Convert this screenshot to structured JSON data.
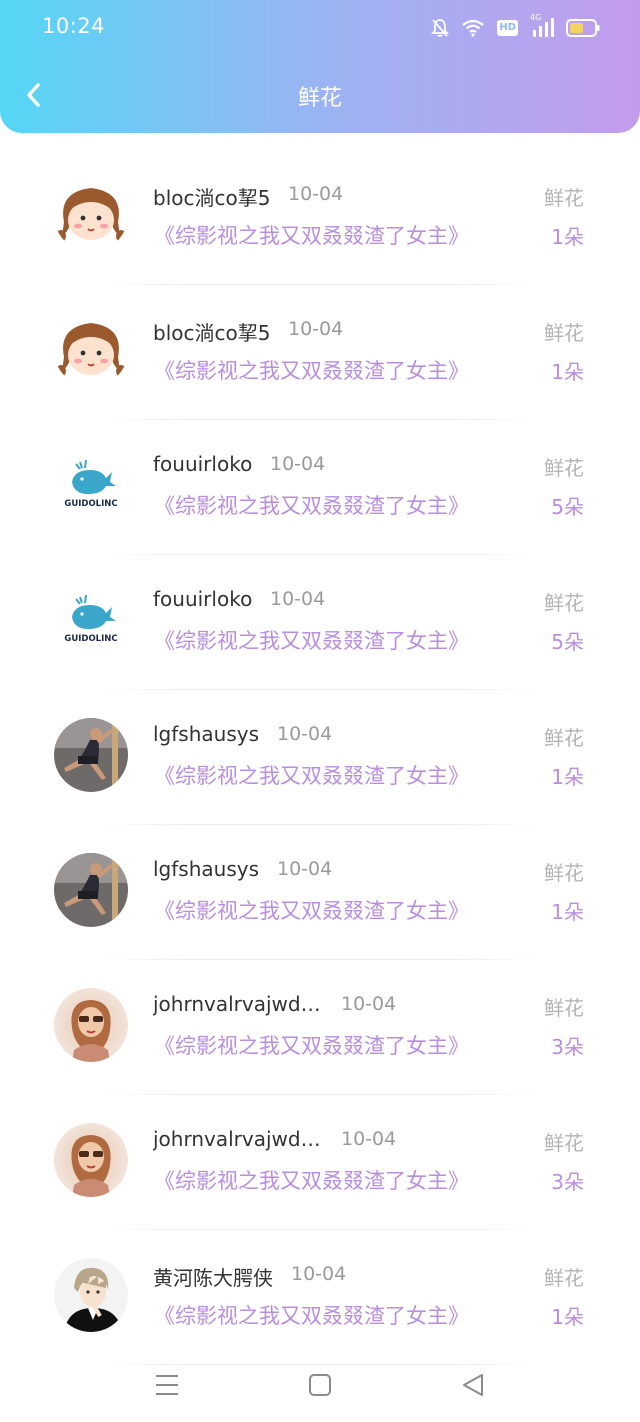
{
  "status_bar": {
    "time": "10:24",
    "hd": "HD",
    "network": "4G",
    "icons": [
      "bell-muted-icon",
      "wifi-icon",
      "hd-icon",
      "signal-icon",
      "battery-icon"
    ]
  },
  "header": {
    "title": "鲜花",
    "back_icon": "chevron-left-icon",
    "gradient": [
      "#55d6f5",
      "#c39cec"
    ]
  },
  "gifts": [
    {
      "user": "bloc淌co挈5",
      "date": "10-04",
      "book": "《综影视之我又双叒叕渣了女主》",
      "type": "鲜花",
      "count": "1朵",
      "avatar": "cartoon-girl"
    },
    {
      "user": "bloc淌co挈5",
      "date": "10-04",
      "book": "《综影视之我又双叒叕渣了女主》",
      "type": "鲜花",
      "count": "1朵",
      "avatar": "cartoon-girl"
    },
    {
      "user": "fouuirloko",
      "date": "10-04",
      "book": "《综影视之我又双叒叕渣了女主》",
      "type": "鲜花",
      "count": "5朵",
      "avatar": "whale-logo",
      "logo_text": "GUIDOLINC"
    },
    {
      "user": "fouuirloko",
      "date": "10-04",
      "book": "《综影视之我又双叒叕渣了女主》",
      "type": "鲜花",
      "count": "5朵",
      "avatar": "whale-logo",
      "logo_text": "GUIDOLINC"
    },
    {
      "user": "lgfshausys",
      "date": "10-04",
      "book": "《综影视之我又双叒叕渣了女主》",
      "type": "鲜花",
      "count": "1朵",
      "avatar": "dancer-photo"
    },
    {
      "user": "lgfshausys",
      "date": "10-04",
      "book": "《综影视之我又双叒叕渣了女主》",
      "type": "鲜花",
      "count": "1朵",
      "avatar": "dancer-photo"
    },
    {
      "user": "johrnvalrvajwdt...",
      "date": "10-04",
      "book": "《综影视之我又双叒叕渣了女主》",
      "type": "鲜花",
      "count": "3朵",
      "avatar": "woman-photo"
    },
    {
      "user": "johrnvalrvajwdt...",
      "date": "10-04",
      "book": "《综影视之我又双叒叕渣了女主》",
      "type": "鲜花",
      "count": "3朵",
      "avatar": "woman-photo"
    },
    {
      "user": "黄河陈大腭侠",
      "date": "10-04",
      "book": "《综影视之我又双叒叕渣了女主》",
      "type": "鲜花",
      "count": "1朵",
      "avatar": "anime-man"
    }
  ],
  "nav_bar": {
    "icons": [
      "menu-icon",
      "home-square-icon",
      "back-triangle-icon"
    ]
  },
  "colors": {
    "accent": "#b98ee0",
    "muted": "#b4b4b4",
    "username": "#333333"
  }
}
